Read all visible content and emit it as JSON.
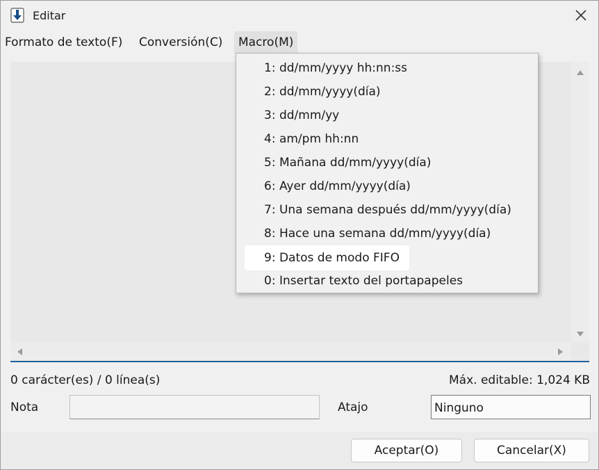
{
  "window": {
    "title": "Editar"
  },
  "icons": {
    "app": "download-arrow-icon",
    "close": "close-icon"
  },
  "menu": [
    {
      "label": "Formato de texto(F)"
    },
    {
      "label": "Conversión(C)"
    },
    {
      "label": "Macro(M)",
      "active": true
    }
  ],
  "macro_menu": {
    "items": [
      "1: dd/mm/yyyy hh:nn:ss",
      "2: dd/mm/yyyy(día)",
      "3: dd/mm/yy",
      "4: am/pm hh:nn",
      "5: Mañana dd/mm/yyyy(día)",
      "6: Ayer dd/mm/yyyy(día)",
      "7: Una semana después dd/mm/yyyy(día)",
      "8: Hace una semana dd/mm/yyyy(día)",
      "9: Datos de modo FIFO",
      "0: Insertar texto del portapapeles"
    ],
    "highlighted_index": 8
  },
  "editor": {
    "text": ""
  },
  "status": {
    "count": "0 carácter(es) / 0 línea(s)",
    "max": "Máx. editable: 1,024 KB"
  },
  "fields": {
    "note_label": "Nota",
    "note_value": "",
    "shortcut_label": "Atajo",
    "shortcut_value": "Ninguno"
  },
  "buttons": {
    "ok": "Aceptar(O)",
    "cancel": "Cancelar(X)"
  },
  "colors": {
    "accent": "#1f5f9a",
    "icon_blue": "#1b4f8a"
  }
}
